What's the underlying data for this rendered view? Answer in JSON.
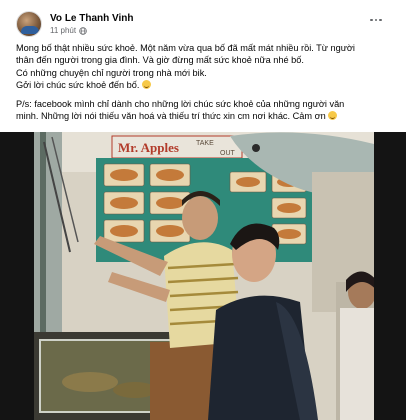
{
  "post": {
    "author": "Vo Le Thanh Vinh",
    "time": "11 phút",
    "privacy_icon": "globe-icon",
    "more_icon": "more-options-icon",
    "lines": [
      "Mong bố thật nhiều sức khoẻ. Một năm vừa qua bố đã mất mát nhiều rồi. Từ người",
      "thân đến người trong gia đình. Và giờ đừng mất sức khoẻ nữa nhé bố.",
      "Có những chuyện chỉ người trong nhà mới bik.",
      "Gởi lời chúc sức khoẻ đến bố."
    ],
    "ps_lines": [
      "P/s: facebook mình chỉ dành cho những lời chúc sức khoẻ của những người văn",
      "minh. Những lời nói thiếu văn hoá và thiếu trí thức xin cm nơi khác. Cảm ơn"
    ],
    "emoji_icon": "smiling-face-emoji-icon"
  },
  "photo": {
    "sign_text": "Mr. Apples",
    "sign_text2": "TAKE",
    "sign_text3": "OUT"
  },
  "colors": {
    "text": "#050505",
    "secondary": "#65676b",
    "background": "#ffffff"
  }
}
